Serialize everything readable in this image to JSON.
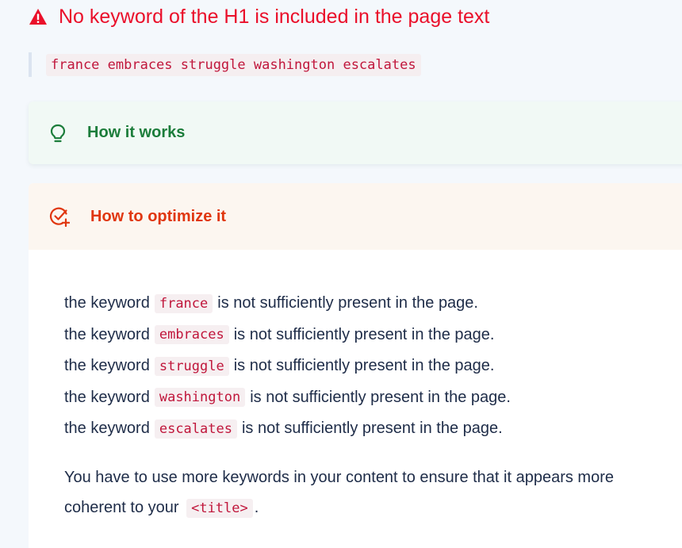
{
  "error": {
    "title": "No keyword of the H1 is included in the page text",
    "icon": "warning-triangle-icon",
    "color": "#ea0f2a"
  },
  "keywords_strip": "france embraces struggle washington escalates",
  "how_it_works": {
    "title": "How it works",
    "icon": "lightbulb-icon",
    "color": "#1c7d3b"
  },
  "how_to_optimize": {
    "title": "How to optimize it",
    "icon": "check-plus-icon",
    "color": "#e0360f",
    "prefix": "the keyword",
    "suffix": "is not sufficiently present in the page.",
    "keywords": [
      "france",
      "embraces",
      "struggle",
      "washington",
      "escalates"
    ],
    "advice_text": "You have to use more keywords in your content to ensure that it appears more coherent to your",
    "advice_code": "<title>",
    "advice_end": "."
  }
}
